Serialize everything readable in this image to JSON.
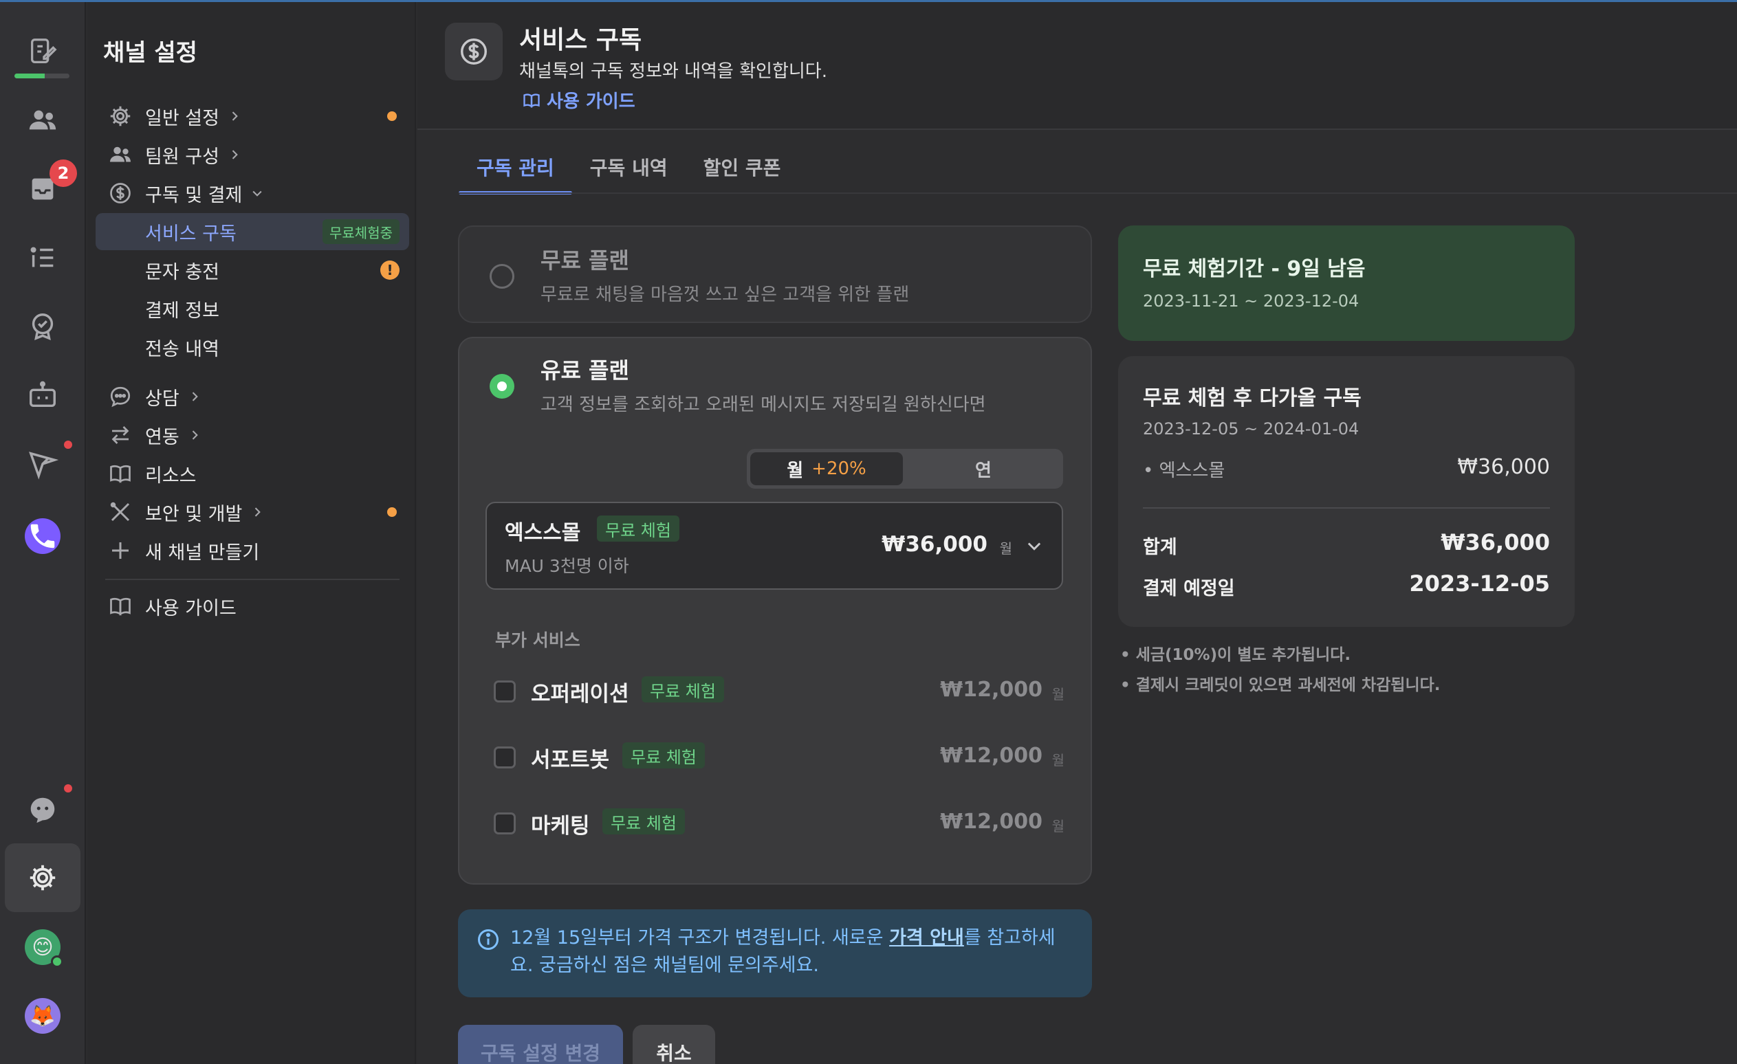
{
  "rail": {
    "inbox_badge": "2",
    "trial_progress": 0.55
  },
  "sidebar": {
    "title": "채널 설정",
    "items": [
      {
        "label": "일반 설정"
      },
      {
        "label": "팀원 구성"
      },
      {
        "label": "구독 및 결제"
      },
      {
        "label": "서비스 구독",
        "pill": "무료체험중"
      },
      {
        "label": "문자 충전",
        "warn": "!"
      },
      {
        "label": "결제 정보"
      },
      {
        "label": "전송 내역"
      },
      {
        "label": "상담"
      },
      {
        "label": "연동"
      },
      {
        "label": "리소스"
      },
      {
        "label": "보안 및 개발"
      },
      {
        "label": "새 채널 만들기"
      },
      {
        "label": "사용 가이드"
      }
    ]
  },
  "header": {
    "title": "서비스 구독",
    "description": "채널톡의 구독 정보와 내역을 확인합니다.",
    "guide_link": "사용 가이드"
  },
  "tabs": [
    {
      "label": "구독 관리"
    },
    {
      "label": "구독 내역"
    },
    {
      "label": "할인 쿠폰"
    }
  ],
  "free_plan": {
    "name": "무료 플랜",
    "description": "무료로 채팅을 마음껏 쓰고 싶은 고객을 위한 플랜"
  },
  "paid_plan": {
    "name": "유료 플랜",
    "description": "고객 정보를 조회하고 오래된 메시지도 저장되길 원하신다면",
    "billing": {
      "monthly": "월",
      "monthly_discount": "+20%",
      "yearly": "연"
    },
    "product": {
      "name": "엑스스몰",
      "pill": "무료 체험",
      "subtitle": "MAU 3천명 이하",
      "price": "₩36,000",
      "unit": "월"
    },
    "addons_title": "부가 서비스",
    "addons": [
      {
        "name": "오퍼레이션",
        "pill": "무료 체험",
        "price": "₩12,000",
        "unit": "월"
      },
      {
        "name": "서포트봇",
        "pill": "무료 체험",
        "price": "₩12,000",
        "unit": "월"
      },
      {
        "name": "마케팅",
        "pill": "무료 체험",
        "price": "₩12,000",
        "unit": "월"
      }
    ]
  },
  "info": {
    "text_before": "12월 15일부터 가격 구조가 변경됩니다. 새로운 ",
    "link": "가격 안내",
    "text_after": "를 참고하세요. 궁금하신 점은 채널팀에 문의주세요."
  },
  "buttons": {
    "apply": "구독 설정 변경",
    "cancel": "취소"
  },
  "trial": {
    "title": "무료 체험기간 - 9일 남음",
    "dates": "2023-11-21 ~ 2023-12-04"
  },
  "summary": {
    "title": "무료 체험 후 다가올 구독",
    "dates": "2023-12-05 ~ 2024-01-04",
    "item_name": "• 엑스스몰",
    "item_price": "₩36,000",
    "total_label": "합계",
    "total_value": "₩36,000",
    "due_label": "결제 예정일",
    "due_value": "2023-12-05"
  },
  "notes": [
    "• 세금(10%)이 별도 추가됩니다.",
    "• 결제시 크레딧이 있으면 과세전에 차감됩니다."
  ],
  "colors": {
    "accent": "#7fa2ff",
    "trial_green": "#4cc46a",
    "warning": "#f5a046",
    "alert": "#e5484d"
  }
}
